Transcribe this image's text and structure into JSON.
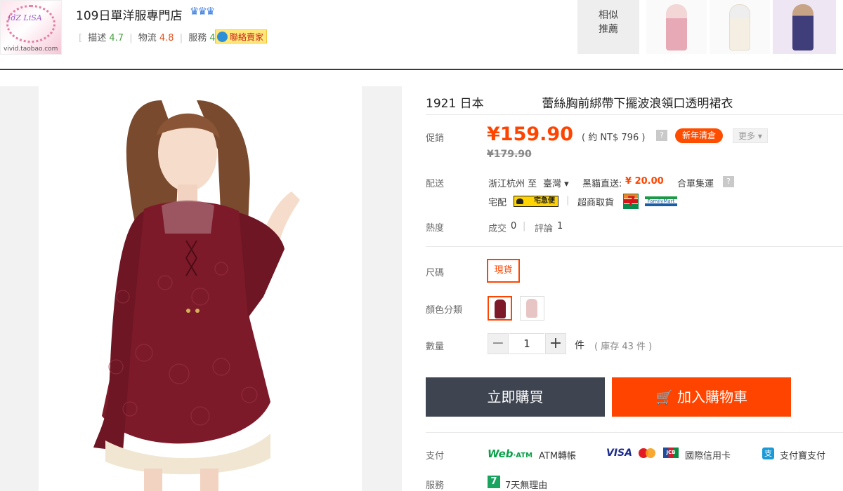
{
  "shop": {
    "logo_text": "IdZ LiSA",
    "logo_url_text": "vivid.taobao.com",
    "name": "109日單洋服專門店",
    "crowns": "♛♛♛",
    "ratings": [
      {
        "label": "描述",
        "value": "4.7"
      },
      {
        "label": "物流",
        "value": "4.8"
      },
      {
        "label": "服務",
        "value": "4.7"
      }
    ],
    "contact_label": "聯絡賣家"
  },
  "similar": {
    "label_line1": "相似",
    "label_line2": "推薦"
  },
  "product": {
    "brand": "1921 日本",
    "title": "蕾絲胸前綁帶下擺波浪領口透明裙衣"
  },
  "price": {
    "promo_label": "促銷",
    "current": "¥159.90",
    "approx": "( 約 NT$ 796 )",
    "help": "?",
    "promo_badge": "新年清倉",
    "more": "更多 ▾",
    "original": "¥179.90"
  },
  "shipping": {
    "label": "配送",
    "from": "浙江杭州 至",
    "to": "臺灣 ▾",
    "method": "黑貓直送:",
    "fee": "¥ 20.00",
    "consolidate": "合單集運",
    "help": "?",
    "home_label": "宅配",
    "home_logo": "宅急便",
    "store_label": "超商取貨",
    "familymart": "FamilyMart"
  },
  "heat": {
    "label": "熱度",
    "sales": "成交",
    "sales_count": "0",
    "reviews": "評論",
    "reviews_count": "1"
  },
  "size": {
    "label": "尺碼",
    "option": "現貨"
  },
  "color": {
    "label": "顏色分類",
    "swatches": [
      "#7d1a2a",
      "#e8c5c5"
    ]
  },
  "quantity": {
    "label": "數量",
    "minus": "−",
    "value": "1",
    "plus": "+",
    "unit": "件",
    "stock": "( 庫存 43 件 )"
  },
  "actions": {
    "buy_now": "立即購買",
    "cart_icon": "🛒",
    "add_to_cart": "加入購物車"
  },
  "payment": {
    "label": "支付",
    "webatm": "Web",
    "webatm_small": "·ATM",
    "atm": "ATM轉帳",
    "visa": "VISA",
    "jcb": "JCB",
    "credit": "國際信用卡",
    "alipay_icon": "支",
    "alipay": "支付寶支付"
  },
  "service": {
    "label": "服務",
    "icon": "7",
    "text": "7天無理由"
  },
  "colors": {
    "accent": "#ff4400",
    "buy_now_bg": "#3e4450",
    "dress": "#7d1a2a"
  }
}
